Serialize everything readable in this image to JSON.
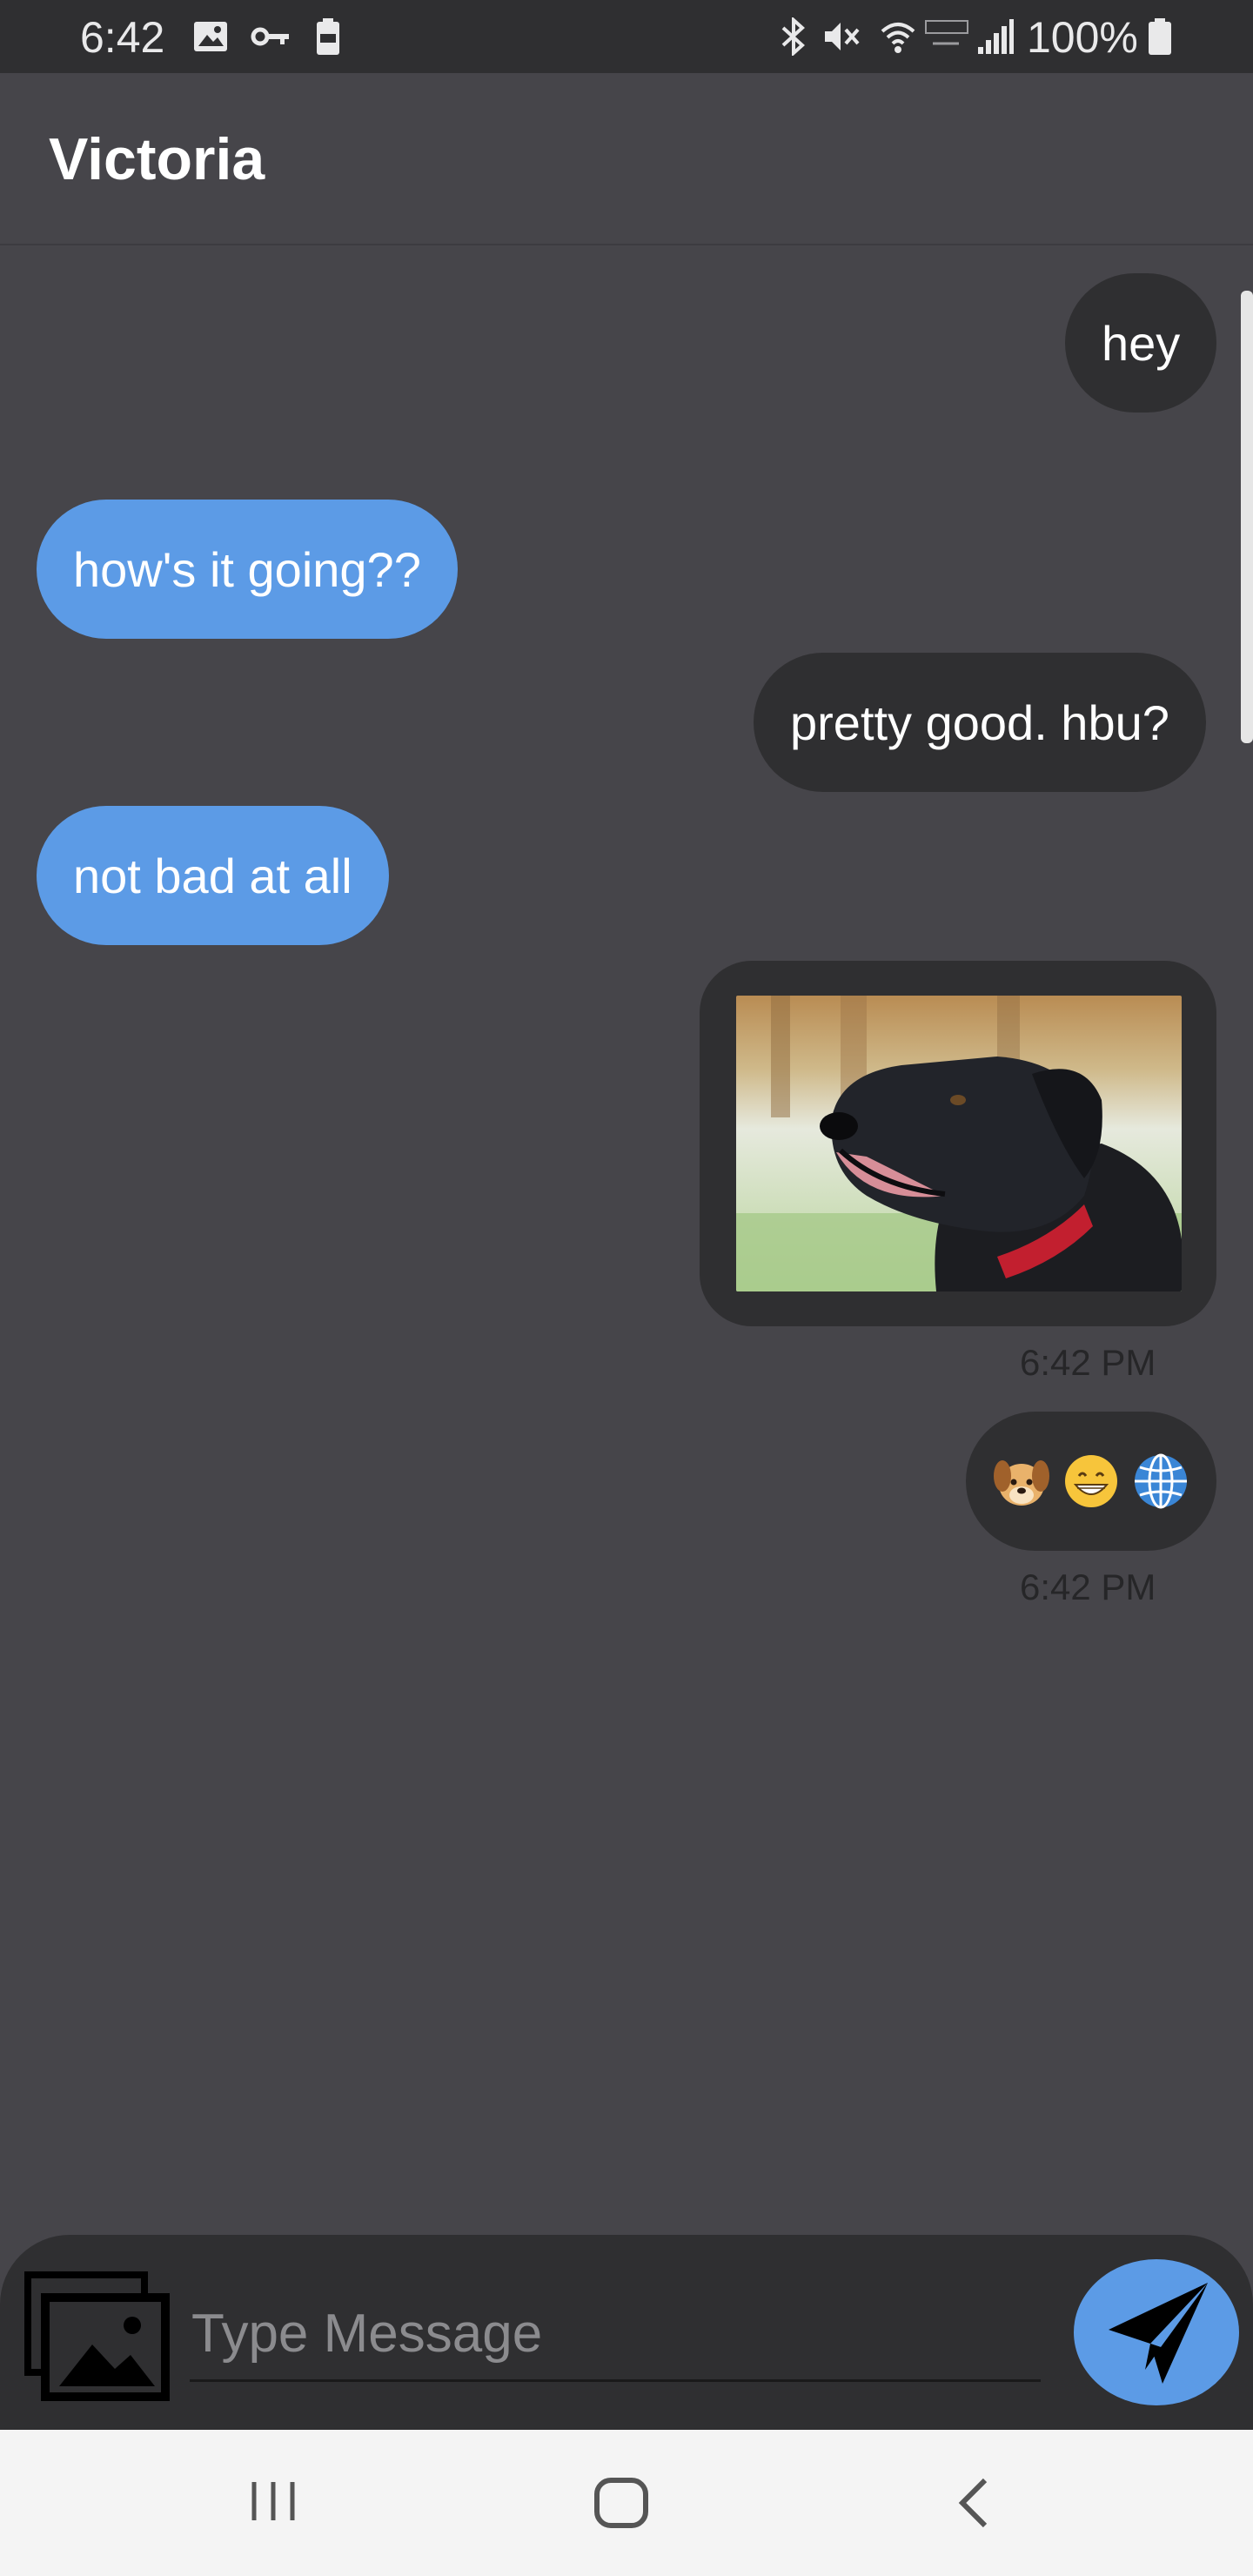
{
  "status_bar": {
    "time": "6:42",
    "battery_percent": "100%",
    "left_icons": [
      "image-notification-icon",
      "vpn-key-icon",
      "battery-saver-icon"
    ],
    "right_icons": [
      "bluetooth-icon",
      "mute-icon",
      "wifi-icon",
      "lte-icon",
      "signal-icon",
      "battery-icon"
    ]
  },
  "header": {
    "title": "Victoria"
  },
  "messages": [
    {
      "sender": "me",
      "text": "hey"
    },
    {
      "sender": "them",
      "text": "how's it going??"
    },
    {
      "sender": "me",
      "text": "pretty good. hbu?"
    },
    {
      "sender": "them",
      "text": "not bad at all"
    },
    {
      "sender": "me",
      "type": "image",
      "image": "dog-photo",
      "time": "6:42 PM"
    },
    {
      "sender": "me",
      "type": "emoji",
      "emojis": [
        "dog-face-emoji",
        "grinning-face-emoji",
        "globe-emoji"
      ],
      "time": "6:42 PM"
    }
  ],
  "composer": {
    "placeholder": "Type Message",
    "gallery_icon": "gallery-icon",
    "send_icon": "send-icon"
  },
  "colors": {
    "background": "#46454a",
    "sent_bubble": "#2f2f31",
    "received_bubble": "#5c9be6",
    "accent": "#5c9be6"
  },
  "navigation": [
    "recent-apps-icon",
    "home-icon",
    "back-icon"
  ]
}
